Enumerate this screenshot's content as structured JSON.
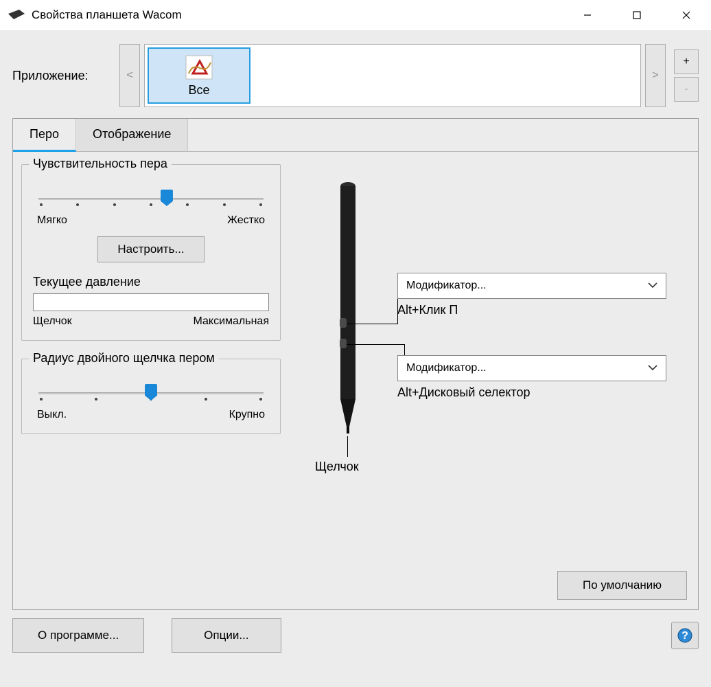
{
  "title": "Свойства планшета Wacom",
  "appRow": {
    "label": "Приложение:",
    "items": [
      {
        "label": "Все"
      }
    ],
    "plus": "+",
    "minus": "-",
    "prev": "<",
    "next": ">"
  },
  "tabs": {
    "pen": "Перо",
    "mapping": "Отображение"
  },
  "tipFeel": {
    "title": "Чувствительность пера",
    "soft": "Мягко",
    "firm": "Жестко",
    "configure": "Настроить...",
    "currentPressure": "Текущее давление",
    "click": "Щелчок",
    "max": "Максимальная",
    "sliderPercent": 57
  },
  "dblClick": {
    "title": "Радиус двойного щелчка пером",
    "off": "Выкл.",
    "large": "Крупно",
    "sliderPercent": 50
  },
  "pen": {
    "button1": {
      "label": "Модификатор...",
      "value": "Alt+Клик П"
    },
    "button2": {
      "label": "Модификатор...",
      "value": "Alt+Дисковый селектор"
    },
    "tipLabel": "Щелчок"
  },
  "buttons": {
    "default": "По умолчанию",
    "about": "О программе...",
    "options": "Опции..."
  }
}
